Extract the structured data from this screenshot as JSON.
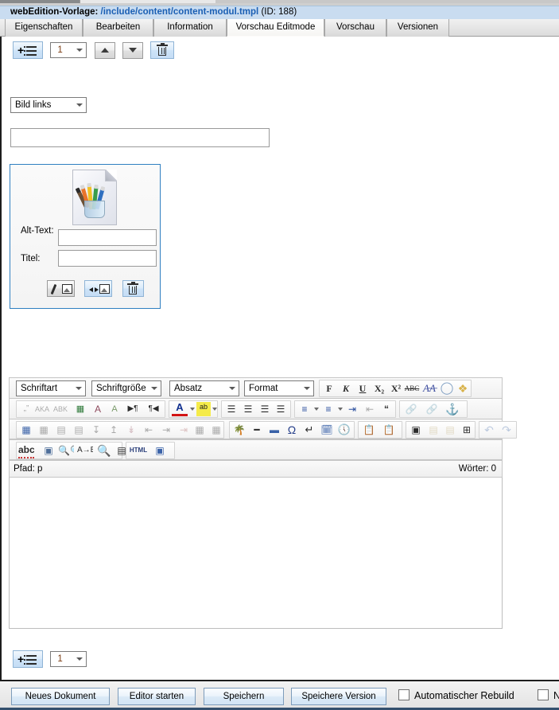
{
  "header": {
    "label": "webEdition-Vorlage",
    "separator": ":",
    "path": "/include/content/content-modul.tmpl",
    "id": "(ID: 188)"
  },
  "tabs": [
    {
      "label": "Eigenschaften",
      "active": false
    },
    {
      "label": "Bearbeiten",
      "active": false
    },
    {
      "label": "Information",
      "active": false
    },
    {
      "label": "Vorschau Editmode",
      "active": true
    },
    {
      "label": "Vorschau",
      "active": false
    },
    {
      "label": "Versionen",
      "active": false
    }
  ],
  "top_toolbar": {
    "add_button_name": "add-block-button",
    "counter_value": "1",
    "up_button_name": "move-up-button",
    "down_button_name": "move-down-button",
    "delete_button_name": "delete-block-button"
  },
  "align_select": {
    "value": "Bild links"
  },
  "headline_input": {
    "value": "",
    "placeholder": ""
  },
  "image_block": {
    "thumbnail_name": "image-placeholder-thumbnail",
    "alt_label": "Alt-Text:",
    "alt_value": "",
    "title_label": "Titel:",
    "title_value": "",
    "edit_button_name": "edit-image-button",
    "swap_button_name": "select-image-button",
    "delete_button_name": "delete-image-button"
  },
  "editor": {
    "font_select": "Schriftart",
    "size_select": "Schriftgröße",
    "paragraph_select": "Absatz",
    "format_select": "Format",
    "bold": "F",
    "italic": "K",
    "underline": "U",
    "subscript": "X₂",
    "superscript": "X²",
    "strikethrough": "ABC",
    "remove_format": "A̶A̶",
    "erase": "erase-icon",
    "paintbrush": "paintbrush-icon",
    "status_path": "Pfad: p",
    "status_words": "Wörter: 0",
    "content": ""
  },
  "bottom_toolbar": {
    "add_button_name": "add-block-button-bottom",
    "counter_value": "1"
  },
  "footer": {
    "buttons": [
      {
        "label": "Neues Dokument",
        "name": "new-document-button"
      },
      {
        "label": "Editor starten",
        "name": "start-editor-button"
      },
      {
        "label": "Speichern",
        "name": "save-button"
      },
      {
        "label": "Speichere Version",
        "name": "save-version-button"
      }
    ],
    "checkboxes": [
      {
        "label": "Automatischer Rebuild",
        "checked": false,
        "name": "auto-rebuild-checkbox"
      },
      {
        "label": "N",
        "checked": false,
        "name": "second-checkbox-truncated"
      }
    ]
  },
  "colors": {
    "header_bg": "#c9dcf0",
    "link_blue": "#1a5fb4",
    "image_box_border": "#2f7fc1",
    "footer_rule": "#34506e"
  }
}
